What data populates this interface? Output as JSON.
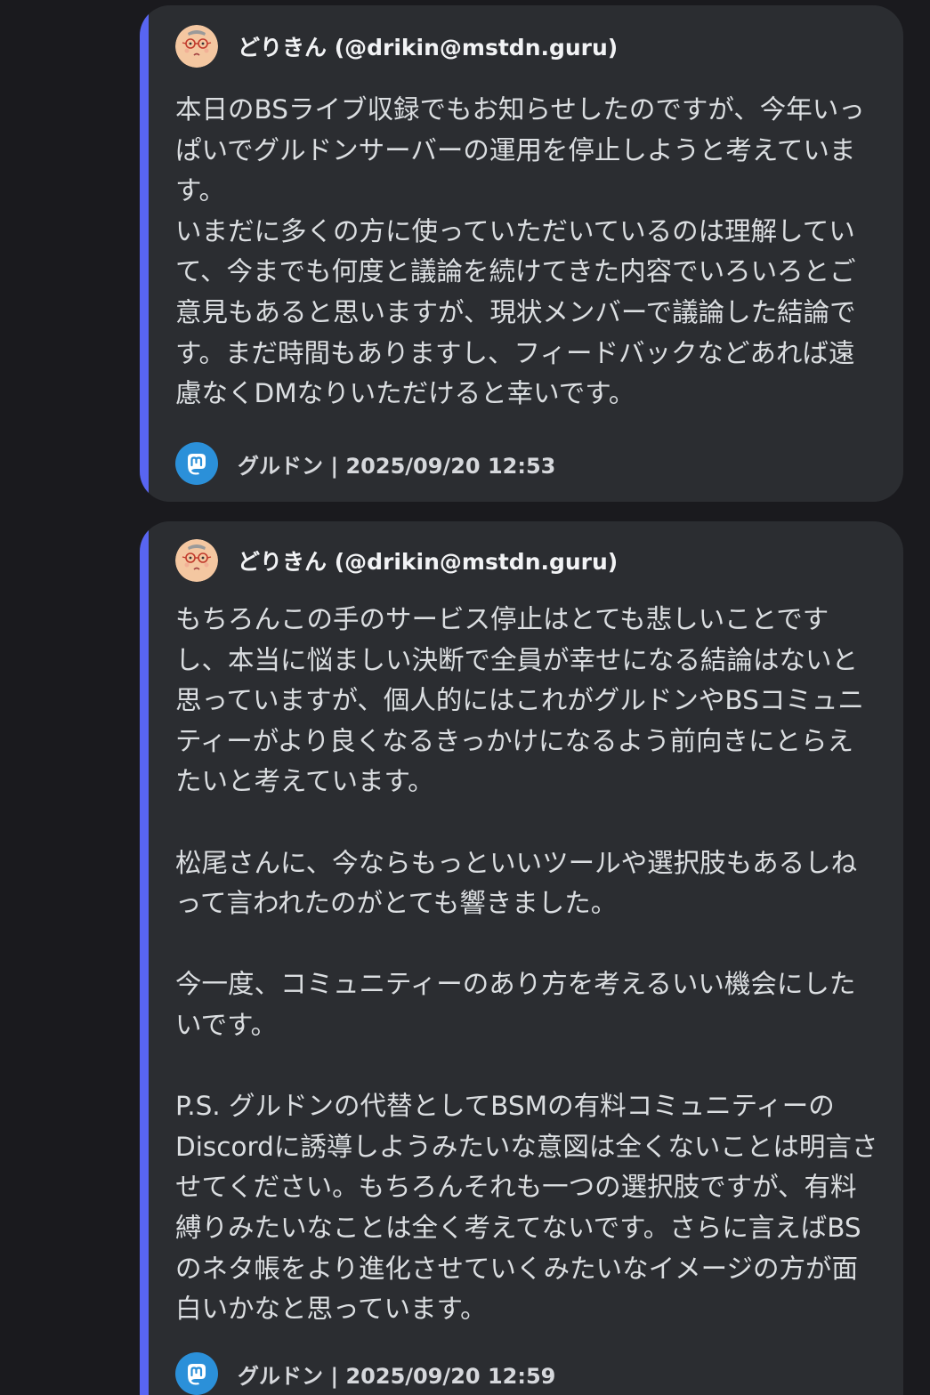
{
  "posts": [
    {
      "author": "どりきん (@drikin@mstdn.guru)",
      "body": "本日のBSライブ収録でもお知らせしたのですが、今年いっぱいでグルドンサーバーの運用を停止しようと考えています。\nいまだに多くの方に使っていただいているのは理解していて、今までも何度と議論を続けてきた内容でいろいろとご意見もあると思いますが、現状メンバーで議論した結論です。まだ時間もありますし、フィードバックなどあれば遠慮なくDMなりいただけると幸いです。",
      "footer": "グルドン | 2025/09/20 12:53"
    },
    {
      "author": "どりきん (@drikin@mstdn.guru)",
      "body": "もちろんこの手のサービス停止はとても悲しいことですし、本当に悩ましい決断で全員が幸せになる結論はないと思っていますが、個人的にはこれがグルドンやBSコミュニティーがより良くなるきっかけになるよう前向きにとらえたいと考えています。\n\n松尾さんに、今ならもっといいツールや選択肢もあるしねって言われたのがとても響きました。\n\n今一度、コミュニティーのあり方を考えるいい機会にしたいです。\n\nP.S. グルドンの代替としてBSMの有料コミュニティーのDiscordに誘導しようみたいな意図は全くないことは明言させてください。もちろんそれも一つの選択肢ですが、有料縛りみたいなことは全く考えてないです。さらに言えばBSのネタ帳をより進化させていくみたいなイメージの方が面白いかなと思っています。",
      "footer": "グルドン | 2025/09/20 12:59"
    }
  ],
  "colors": {
    "background": "#1a1a1e",
    "embed": "#2b2d31",
    "accent": "#5865f2",
    "mastodon": "#2b90d9"
  },
  "icons": {
    "author_avatar": "cartoon-face-with-glasses-icon",
    "source": "mastodon-logo-icon"
  }
}
